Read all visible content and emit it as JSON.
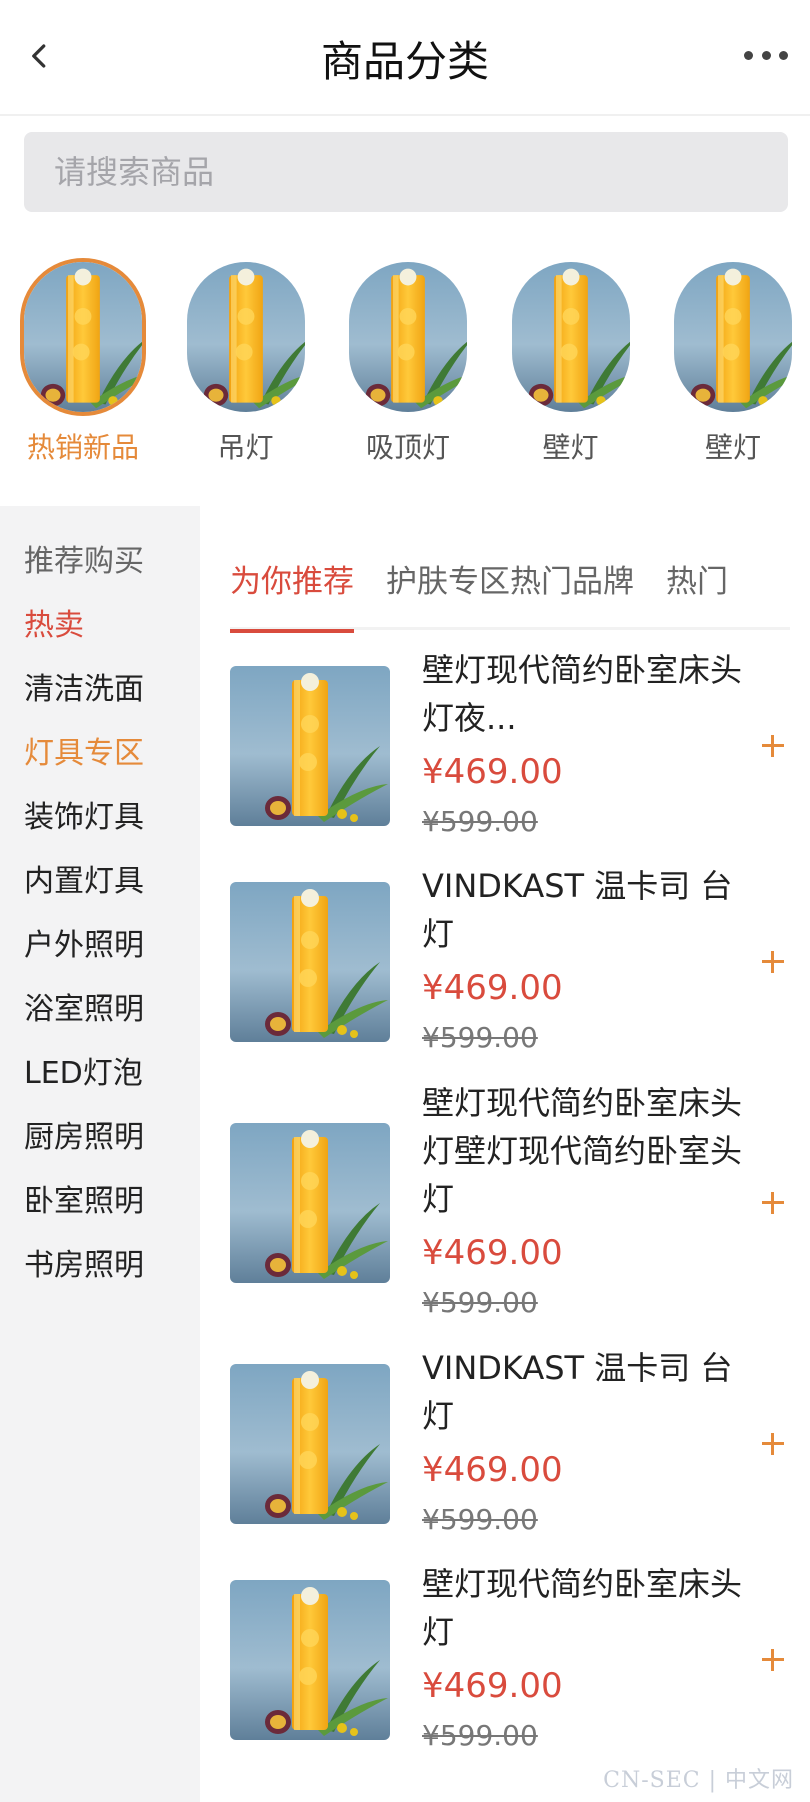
{
  "header": {
    "title": "商品分类"
  },
  "search": {
    "placeholder": "请搜索商品"
  },
  "categories": [
    {
      "label": "热销新品",
      "active": true
    },
    {
      "label": "吊灯",
      "active": false
    },
    {
      "label": "吸顶灯",
      "active": false
    },
    {
      "label": "壁灯",
      "active": false
    },
    {
      "label": "壁灯",
      "active": false
    }
  ],
  "sidebar": {
    "heading": "推荐购买",
    "items": [
      {
        "label": "热卖",
        "color": "red"
      },
      {
        "label": "清洁洗面",
        "color": "normal"
      },
      {
        "label": "灯具专区",
        "color": "orange"
      },
      {
        "label": "装饰灯具",
        "color": "normal"
      },
      {
        "label": "内置灯具",
        "color": "normal"
      },
      {
        "label": "户外照明",
        "color": "normal"
      },
      {
        "label": "浴室照明",
        "color": "normal"
      },
      {
        "label": "LED灯泡",
        "color": "normal"
      },
      {
        "label": "厨房照明",
        "color": "normal"
      },
      {
        "label": "卧室照明",
        "color": "normal"
      },
      {
        "label": "书房照明",
        "color": "normal"
      }
    ]
  },
  "tabs": [
    {
      "label": "为你推荐",
      "active": true
    },
    {
      "label": "护肤专区",
      "active": false
    },
    {
      "label": "热门品牌",
      "active": false
    },
    {
      "label": "热门",
      "active": false
    }
  ],
  "products": [
    {
      "name": "壁灯现代简约卧室床头灯夜...",
      "price": "¥469.00",
      "old_price": "¥599.00"
    },
    {
      "name": "VINDKAST 温卡司 台灯",
      "price": "¥469.00",
      "old_price": "¥599.00"
    },
    {
      "name": "壁灯现代简约卧室床头灯壁灯现代简约卧室头灯",
      "price": "¥469.00",
      "old_price": "¥599.00"
    },
    {
      "name": "VINDKAST 温卡司 台灯",
      "price": "¥469.00",
      "old_price": "¥599.00"
    },
    {
      "name": "壁灯现代简约卧室床头灯",
      "price": "¥469.00",
      "old_price": "¥599.00"
    }
  ],
  "watermark": "CN-SEC | 中文网",
  "colors": {
    "accent_red": "#d94b3d",
    "accent_orange": "#e58a3a",
    "sidebar_bg": "#f3f3f4",
    "search_bg": "#e8e8ea"
  },
  "icons": {
    "back": "chevron-left-icon",
    "more": "more-dots-icon",
    "add": "plus-icon",
    "product_image": "drink-photo"
  }
}
